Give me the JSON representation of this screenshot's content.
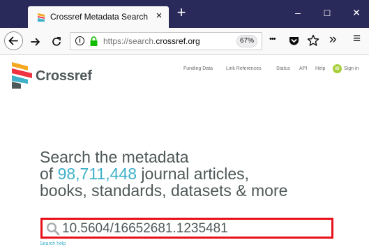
{
  "browser": {
    "tab_title": "Crossref Metadata Search",
    "tab_close": "×",
    "new_tab": "+",
    "window_controls": {
      "minimize": "–",
      "maximize": "☐",
      "close": "✕"
    },
    "url_prefix": "https://search.",
    "url_domain": "crossref.org",
    "zoom": "67%",
    "nav_icons": [
      "back-icon",
      "forward-icon",
      "reload-icon",
      "info-icon",
      "lock-icon",
      "more-icon",
      "pocket-icon",
      "star-icon",
      "overflow-icon",
      "menu-icon"
    ],
    "more_label": "•••",
    "overflow_label": "»",
    "menu_label": "≡"
  },
  "header": {
    "logo_text": "Crossref",
    "links": [
      "Funding Data",
      "Link References",
      "Status",
      "API",
      "Help"
    ],
    "orcid_label": "iD",
    "sign_in": "Sign in"
  },
  "hero": {
    "line1": "Search the metadata",
    "line2_prefix": "of ",
    "count": "98,711,448",
    "line2_suffix": " journal articles,",
    "line3": "books, standards, datasets & more"
  },
  "search": {
    "value": "10.5604/16652681.1235481",
    "help": "Search help"
  },
  "colors": {
    "titlebar": "#2a2a5a",
    "accent": "#3eb1c8",
    "text": "#4f5858",
    "highlight_border": "#e8111a",
    "orcid": "#a6ce39"
  }
}
